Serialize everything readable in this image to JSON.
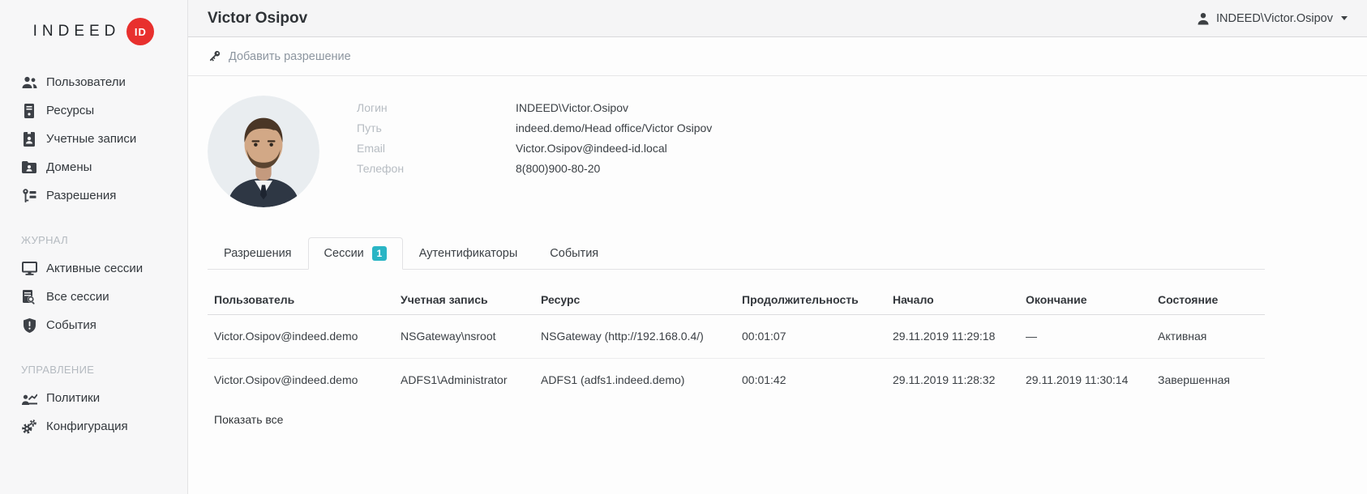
{
  "brand": {
    "wordmark": "INDEED",
    "badge": "ID",
    "badge_color": "#e8302e"
  },
  "sidebar": {
    "groups": [
      {
        "items": [
          {
            "label": "Пользователи",
            "icon": "users-icon"
          },
          {
            "label": "Ресурсы",
            "icon": "server-icon"
          },
          {
            "label": "Учетные записи",
            "icon": "id-badge-icon"
          },
          {
            "label": "Домены",
            "icon": "domain-folder-icon"
          },
          {
            "label": "Разрешения",
            "icon": "key-icon"
          }
        ]
      },
      {
        "header": "ЖУРНАЛ",
        "items": [
          {
            "label": "Активные сессии",
            "icon": "monitor-icon"
          },
          {
            "label": "Все сессии",
            "icon": "session-log-icon"
          },
          {
            "label": "События",
            "icon": "shield-alert-icon"
          }
        ]
      },
      {
        "header": "УПРАВЛЕНИЕ",
        "items": [
          {
            "label": "Политики",
            "icon": "policy-icon"
          },
          {
            "label": "Конфигурация",
            "icon": "gears-icon"
          }
        ]
      }
    ]
  },
  "header": {
    "title": "Victor Osipov",
    "account": "INDEED\\Victor.Osipov"
  },
  "toolbar": {
    "add_permission_label": "Добавить разрешение"
  },
  "profile": {
    "fields": [
      {
        "label": "Логин",
        "value": "INDEED\\Victor.Osipov"
      },
      {
        "label": "Путь",
        "value": "indeed.demo/Head office/Victor Osipov"
      },
      {
        "label": "Email",
        "value": "Victor.Osipov@indeed-id.local"
      },
      {
        "label": "Телефон",
        "value": "8(800)900-80-20"
      }
    ]
  },
  "tabs": [
    {
      "label": "Разрешения",
      "active": false
    },
    {
      "label": "Сессии",
      "badge": "1",
      "active": true
    },
    {
      "label": "Аутентификаторы",
      "active": false
    },
    {
      "label": "События",
      "active": false
    }
  ],
  "sessions_table": {
    "columns": [
      "Пользователь",
      "Учетная запись",
      "Ресурс",
      "Продолжительность",
      "Начало",
      "Окончание",
      "Состояние"
    ],
    "rows": [
      [
        "Victor.Osipov@indeed.demo",
        "NSGateway\\nsroot",
        "NSGateway (http://192.168.0.4/)",
        "00:01:07",
        "29.11.2019 11:29:18",
        "—",
        "Активная"
      ],
      [
        "Victor.Osipov@indeed.demo",
        "ADFS1\\Administrator",
        "ADFS1 (adfs1.indeed.demo)",
        "00:01:42",
        "29.11.2019 11:28:32",
        "29.11.2019 11:30:14",
        "Завершенная"
      ]
    ]
  },
  "footer": {
    "show_all_label": "Показать все"
  },
  "colors": {
    "accent_red": "#e8302e",
    "badge_teal": "#2ab5c5"
  }
}
